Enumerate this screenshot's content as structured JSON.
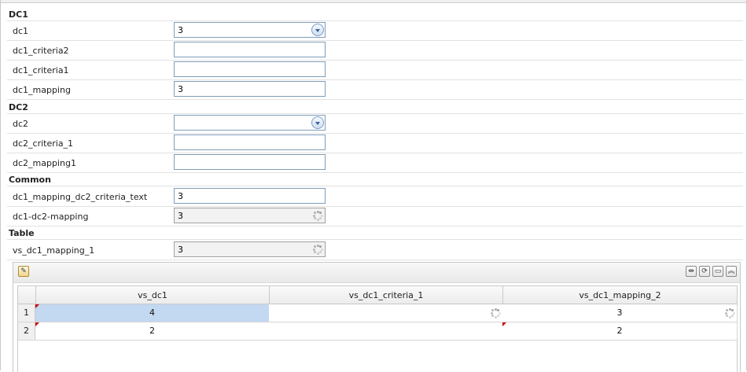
{
  "form": {
    "dc1": {
      "heading": "DC1",
      "fields": [
        {
          "label": "dc1",
          "value": "3",
          "kind": "dropdown"
        },
        {
          "label": "dc1_criteria2",
          "value": "",
          "kind": "text"
        },
        {
          "label": "dc1_criteria1",
          "value": "",
          "kind": "text"
        },
        {
          "label": "dc1_mapping",
          "value": "3",
          "kind": "text"
        }
      ]
    },
    "dc2": {
      "heading": "DC2",
      "fields": [
        {
          "label": "dc2",
          "value": "",
          "kind": "dropdown"
        },
        {
          "label": "dc2_criteria_1",
          "value": "",
          "kind": "text"
        },
        {
          "label": "dc2_mapping1",
          "value": "",
          "kind": "text"
        }
      ]
    },
    "common": {
      "heading": "Common",
      "fields": [
        {
          "label": "dc1_mapping_dc2_criteria_text",
          "value": "3",
          "kind": "text"
        },
        {
          "label": "dc1-dc2-mapping",
          "value": "3",
          "kind": "readonly-loading"
        }
      ]
    },
    "table": {
      "heading": "Table",
      "fields": [
        {
          "label": "vs_dc1_mapping_1",
          "value": "3",
          "kind": "readonly-loading"
        }
      ]
    }
  },
  "grid": {
    "toolbar_icons": [
      "edit-icon",
      "expand-icon",
      "refresh-icon",
      "maximize-icon",
      "collapse-icon"
    ],
    "columns": [
      "vs_dc1",
      "vs_dc1_criteria_1",
      "vs_dc1_mapping_2"
    ],
    "rows": [
      {
        "num": "1",
        "cells": [
          "4",
          "",
          "3"
        ]
      },
      {
        "num": "2",
        "cells": [
          "2",
          "",
          "2"
        ]
      }
    ]
  },
  "colors": {
    "selected_cell": "#c3d8f1",
    "field_border": "#7f9db9",
    "dirty_marker": "#cc0000"
  }
}
